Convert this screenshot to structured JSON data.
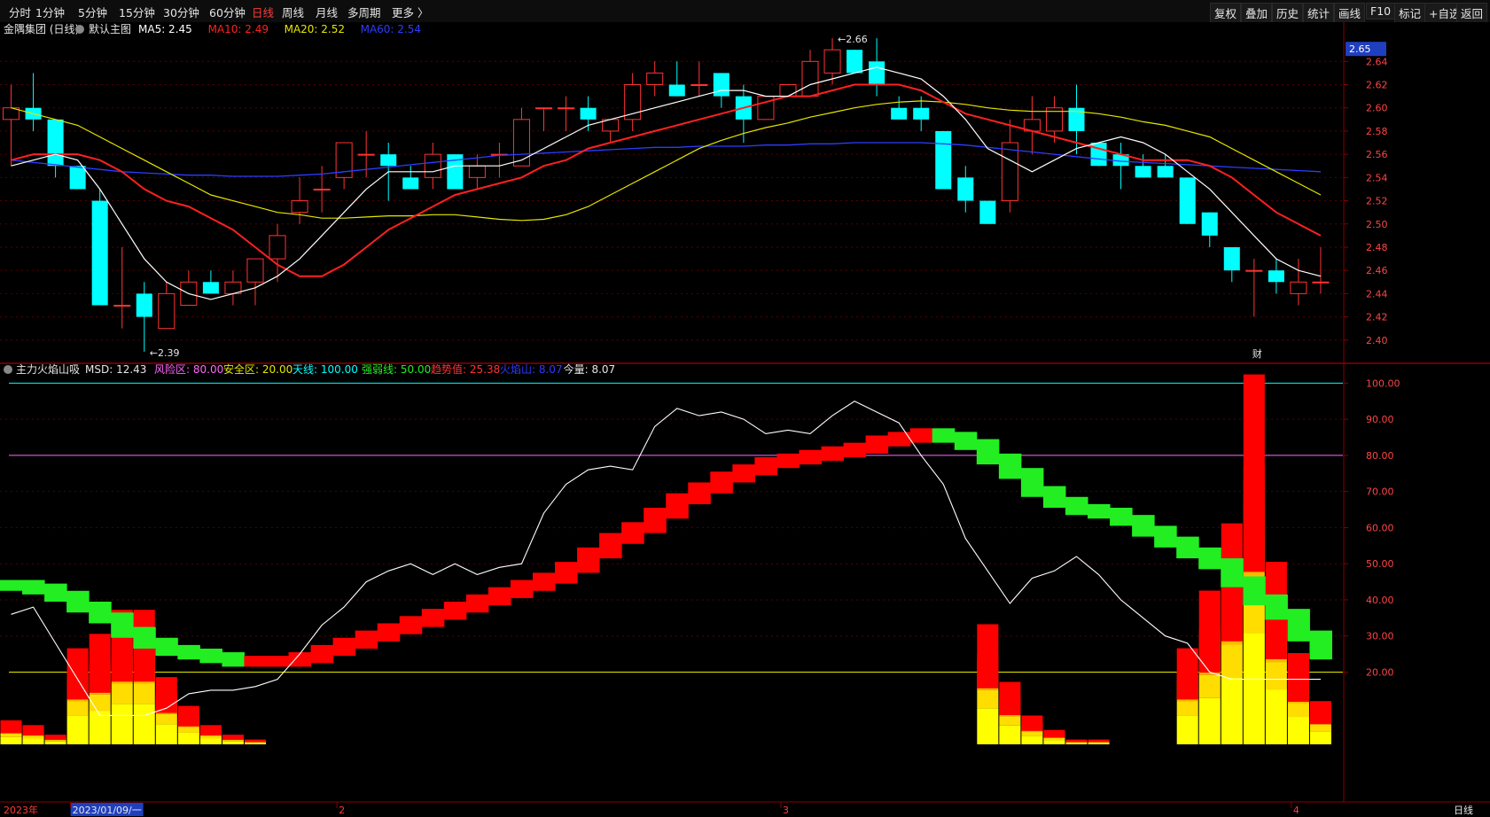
{
  "toolbar": {
    "periods": [
      "分时",
      "1分钟",
      "5分钟",
      "15分钟",
      "30分钟",
      "60分钟",
      "日线",
      "周线",
      "月线",
      "多周期",
      "更多 〉"
    ],
    "active_period": "日线",
    "right_buttons": [
      "复权",
      "叠加",
      "历史",
      "统计",
      "画线",
      "F10",
      "标记",
      "+自选",
      "返回"
    ]
  },
  "colors": {
    "up": "#ff3333",
    "down": "#00ffff",
    "ma5": "#ffffff",
    "ma10": "#ff2020",
    "ma20": "#e6e600",
    "ma60": "#2d3cff",
    "msd_line": "#ffffff",
    "red_band": "#ff0000",
    "green_band": "#22ee22",
    "risk_line": "#ff66ff",
    "safe_line": "#e6e600",
    "sky_line": "#00ffff"
  },
  "chart_data": [
    {
      "type": "candlestick",
      "title": "金隅集团 (日线)",
      "main_label": "默认主图",
      "indicators": [
        {
          "name": "MA5",
          "value": "2.45",
          "color": "#ffffff"
        },
        {
          "name": "MA10",
          "value": "2.49",
          "color": "#ff2020"
        },
        {
          "name": "MA20",
          "value": "2.52",
          "color": "#e6e600"
        },
        {
          "name": "MA60",
          "value": "2.54",
          "color": "#2d3cff"
        }
      ],
      "ylim": [
        2.38,
        2.67
      ],
      "yticks": [
        "2.40",
        "2.42",
        "2.44",
        "2.46",
        "2.48",
        "2.50",
        "2.52",
        "2.54",
        "2.56",
        "2.58",
        "2.60",
        "2.62",
        "2.64"
      ],
      "current_price": "2.65",
      "annotations": [
        {
          "text": "2.66",
          "index": 37,
          "value": 2.66
        },
        {
          "text": "2.39",
          "index": 6,
          "value": 2.39
        }
      ],
      "marker": {
        "text": "财",
        "index": 56
      },
      "candles": [
        {
          "o": 2.59,
          "h": 2.62,
          "l": 2.55,
          "c": 2.6
        },
        {
          "o": 2.6,
          "h": 2.63,
          "l": 2.58,
          "c": 2.59
        },
        {
          "o": 2.59,
          "h": 2.59,
          "l": 2.54,
          "c": 2.55
        },
        {
          "o": 2.55,
          "h": 2.55,
          "l": 2.53,
          "c": 2.53
        },
        {
          "o": 2.52,
          "h": 2.53,
          "l": 2.43,
          "c": 2.43
        },
        {
          "o": 2.43,
          "h": 2.48,
          "l": 2.41,
          "c": 2.43
        },
        {
          "o": 2.44,
          "h": 2.45,
          "l": 2.39,
          "c": 2.42
        },
        {
          "o": 2.41,
          "h": 2.45,
          "l": 2.41,
          "c": 2.44
        },
        {
          "o": 2.43,
          "h": 2.46,
          "l": 2.43,
          "c": 2.45
        },
        {
          "o": 2.45,
          "h": 2.46,
          "l": 2.44,
          "c": 2.44
        },
        {
          "o": 2.44,
          "h": 2.46,
          "l": 2.43,
          "c": 2.45
        },
        {
          "o": 2.45,
          "h": 2.47,
          "l": 2.43,
          "c": 2.47
        },
        {
          "o": 2.47,
          "h": 2.5,
          "l": 2.45,
          "c": 2.49
        },
        {
          "o": 2.51,
          "h": 2.54,
          "l": 2.5,
          "c": 2.52
        },
        {
          "o": 2.53,
          "h": 2.55,
          "l": 2.51,
          "c": 2.53
        },
        {
          "o": 2.54,
          "h": 2.57,
          "l": 2.53,
          "c": 2.57
        },
        {
          "o": 2.56,
          "h": 2.58,
          "l": 2.54,
          "c": 2.56
        },
        {
          "o": 2.56,
          "h": 2.57,
          "l": 2.52,
          "c": 2.55
        },
        {
          "o": 2.54,
          "h": 2.55,
          "l": 2.53,
          "c": 2.53
        },
        {
          "o": 2.54,
          "h": 2.57,
          "l": 2.53,
          "c": 2.56
        },
        {
          "o": 2.56,
          "h": 2.56,
          "l": 2.53,
          "c": 2.53
        },
        {
          "o": 2.54,
          "h": 2.56,
          "l": 2.53,
          "c": 2.55
        },
        {
          "o": 2.56,
          "h": 2.57,
          "l": 2.54,
          "c": 2.56
        },
        {
          "o": 2.55,
          "h": 2.6,
          "l": 2.55,
          "c": 2.59
        },
        {
          "o": 2.6,
          "h": 2.6,
          "l": 2.58,
          "c": 2.6
        },
        {
          "o": 2.6,
          "h": 2.61,
          "l": 2.58,
          "c": 2.6
        },
        {
          "o": 2.6,
          "h": 2.61,
          "l": 2.58,
          "c": 2.59
        },
        {
          "o": 2.58,
          "h": 2.59,
          "l": 2.57,
          "c": 2.59
        },
        {
          "o": 2.59,
          "h": 2.63,
          "l": 2.58,
          "c": 2.62
        },
        {
          "o": 2.62,
          "h": 2.64,
          "l": 2.61,
          "c": 2.63
        },
        {
          "o": 2.62,
          "h": 2.64,
          "l": 2.61,
          "c": 2.61
        },
        {
          "o": 2.62,
          "h": 2.64,
          "l": 2.61,
          "c": 2.62
        },
        {
          "o": 2.63,
          "h": 2.63,
          "l": 2.6,
          "c": 2.61
        },
        {
          "o": 2.61,
          "h": 2.62,
          "l": 2.57,
          "c": 2.59
        },
        {
          "o": 2.59,
          "h": 2.61,
          "l": 2.59,
          "c": 2.61
        },
        {
          "o": 2.61,
          "h": 2.62,
          "l": 2.61,
          "c": 2.62
        },
        {
          "o": 2.61,
          "h": 2.65,
          "l": 2.61,
          "c": 2.64
        },
        {
          "o": 2.63,
          "h": 2.66,
          "l": 2.62,
          "c": 2.65
        },
        {
          "o": 2.65,
          "h": 2.65,
          "l": 2.63,
          "c": 2.63
        },
        {
          "o": 2.64,
          "h": 2.66,
          "l": 2.61,
          "c": 2.62
        },
        {
          "o": 2.6,
          "h": 2.61,
          "l": 2.59,
          "c": 2.59
        },
        {
          "o": 2.6,
          "h": 2.61,
          "l": 2.58,
          "c": 2.59
        },
        {
          "o": 2.58,
          "h": 2.58,
          "l": 2.53,
          "c": 2.53
        },
        {
          "o": 2.54,
          "h": 2.55,
          "l": 2.51,
          "c": 2.52
        },
        {
          "o": 2.52,
          "h": 2.52,
          "l": 2.5,
          "c": 2.5
        },
        {
          "o": 2.52,
          "h": 2.59,
          "l": 2.51,
          "c": 2.57
        },
        {
          "o": 2.58,
          "h": 2.61,
          "l": 2.56,
          "c": 2.59
        },
        {
          "o": 2.58,
          "h": 2.61,
          "l": 2.57,
          "c": 2.6
        },
        {
          "o": 2.6,
          "h": 2.62,
          "l": 2.56,
          "c": 2.58
        },
        {
          "o": 2.57,
          "h": 2.57,
          "l": 2.55,
          "c": 2.55
        },
        {
          "o": 2.56,
          "h": 2.57,
          "l": 2.53,
          "c": 2.55
        },
        {
          "o": 2.55,
          "h": 2.56,
          "l": 2.54,
          "c": 2.54
        },
        {
          "o": 2.55,
          "h": 2.56,
          "l": 2.54,
          "c": 2.54
        },
        {
          "o": 2.54,
          "h": 2.54,
          "l": 2.5,
          "c": 2.5
        },
        {
          "o": 2.51,
          "h": 2.51,
          "l": 2.48,
          "c": 2.49
        },
        {
          "o": 2.48,
          "h": 2.48,
          "l": 2.45,
          "c": 2.46
        },
        {
          "o": 2.46,
          "h": 2.47,
          "l": 2.42,
          "c": 2.46
        },
        {
          "o": 2.46,
          "h": 2.47,
          "l": 2.44,
          "c": 2.45
        },
        {
          "o": 2.44,
          "h": 2.47,
          "l": 2.43,
          "c": 2.45
        },
        {
          "o": 2.45,
          "h": 2.48,
          "l": 2.44,
          "c": 2.45
        }
      ],
      "ma5": [
        2.55,
        2.555,
        2.56,
        2.555,
        2.53,
        2.5,
        2.47,
        2.45,
        2.44,
        2.435,
        2.44,
        2.445,
        2.455,
        2.47,
        2.49,
        2.51,
        2.53,
        2.545,
        2.545,
        2.545,
        2.55,
        2.55,
        2.55,
        2.555,
        2.565,
        2.575,
        2.585,
        2.59,
        2.595,
        2.6,
        2.605,
        2.61,
        2.615,
        2.615,
        2.61,
        2.61,
        2.62,
        2.625,
        2.63,
        2.635,
        2.63,
        2.625,
        2.61,
        2.59,
        2.565,
        2.555,
        2.545,
        2.555,
        2.565,
        2.57,
        2.575,
        2.57,
        2.56,
        2.545,
        2.53,
        2.51,
        2.49,
        2.47,
        2.46,
        2.455
      ],
      "ma10": [
        2.555,
        2.56,
        2.56,
        2.56,
        2.555,
        2.545,
        2.53,
        2.52,
        2.515,
        2.505,
        2.495,
        2.48,
        2.465,
        2.455,
        2.455,
        2.465,
        2.48,
        2.495,
        2.505,
        2.515,
        2.525,
        2.53,
        2.535,
        2.54,
        2.55,
        2.555,
        2.565,
        2.57,
        2.575,
        2.58,
        2.585,
        2.59,
        2.595,
        2.6,
        2.605,
        2.61,
        2.61,
        2.615,
        2.62,
        2.62,
        2.62,
        2.615,
        2.605,
        2.595,
        2.59,
        2.585,
        2.58,
        2.575,
        2.57,
        2.565,
        2.56,
        2.555,
        2.555,
        2.555,
        2.55,
        2.54,
        2.525,
        2.51,
        2.5,
        2.49
      ],
      "ma20": [
        2.6,
        2.595,
        2.59,
        2.585,
        2.575,
        2.565,
        2.555,
        2.545,
        2.535,
        2.525,
        2.52,
        2.515,
        2.51,
        2.508,
        2.505,
        2.505,
        2.506,
        2.507,
        2.507,
        2.508,
        2.508,
        2.506,
        2.504,
        2.503,
        2.504,
        2.508,
        2.515,
        2.525,
        2.535,
        2.545,
        2.555,
        2.565,
        2.572,
        2.578,
        2.583,
        2.587,
        2.592,
        2.596,
        2.6,
        2.603,
        2.605,
        2.606,
        2.605,
        2.603,
        2.6,
        2.598,
        2.597,
        2.597,
        2.597,
        2.595,
        2.592,
        2.588,
        2.585,
        2.58,
        2.575,
        2.565,
        2.555,
        2.545,
        2.535,
        2.525
      ],
      "ma60": [
        2.555,
        2.553,
        2.551,
        2.549,
        2.547,
        2.545,
        2.544,
        2.543,
        2.542,
        2.542,
        2.541,
        2.541,
        2.541,
        2.542,
        2.543,
        2.545,
        2.547,
        2.549,
        2.551,
        2.553,
        2.555,
        2.557,
        2.559,
        2.56,
        2.561,
        2.562,
        2.563,
        2.564,
        2.565,
        2.566,
        2.566,
        2.567,
        2.567,
        2.567,
        2.568,
        2.568,
        2.569,
        2.569,
        2.57,
        2.57,
        2.57,
        2.57,
        2.569,
        2.568,
        2.566,
        2.564,
        2.562,
        2.56,
        2.558,
        2.556,
        2.554,
        2.553,
        2.552,
        2.551,
        2.55,
        2.549,
        2.548,
        2.547,
        2.546,
        2.545
      ]
    },
    {
      "type": "indicator",
      "title": "主力火焰山吸",
      "labels": [
        {
          "name": "MSD",
          "value": "12.43",
          "color": "#e6e6e6"
        },
        {
          "name": "风险区",
          "value": "80.00",
          "color": "#ff66ff"
        },
        {
          "name": "安全区",
          "value": "20.00",
          "color": "#e6e600"
        },
        {
          "name": "天线",
          "value": "100.00",
          "color": "#00ffff"
        },
        {
          "name": "强弱线",
          "value": "50.00",
          "color": "#22ee22"
        },
        {
          "name": "趋势值",
          "value": "25.38",
          "color": "#ff3333"
        },
        {
          "name": "火焰山",
          "value": "8.07",
          "color": "#2d3cff"
        },
        {
          "name": "今量",
          "value": "8.07",
          "color": "#e6e6e6"
        }
      ],
      "ylim": [
        0,
        105
      ],
      "yticks": [
        "20.00",
        "30.00",
        "40.00",
        "50.00",
        "60.00",
        "70.00",
        "80.00",
        "90.00",
        "100.00"
      ],
      "levels": {
        "sky": 100,
        "risk": 80,
        "strong_weak": 50,
        "safe": 20
      },
      "msd": [
        36,
        38,
        28,
        18,
        8,
        8,
        8,
        10,
        14,
        15,
        15,
        16,
        18,
        25,
        33,
        38,
        45,
        48,
        50,
        47,
        50,
        47,
        49,
        50,
        64,
        72,
        76,
        77,
        76,
        88,
        93,
        91,
        92,
        90,
        86,
        87,
        86,
        91,
        95,
        92,
        89,
        80,
        72,
        57,
        48,
        39,
        46,
        48,
        52,
        47,
        40,
        35,
        30,
        28,
        20,
        18,
        18,
        18,
        18,
        18
      ],
      "trend": [
        44,
        43,
        41,
        38,
        35,
        31,
        28,
        26,
        25,
        24,
        23,
        23,
        23,
        24,
        26,
        28,
        30,
        32,
        34,
        36,
        38,
        40,
        42,
        44,
        46,
        49,
        53,
        57,
        60,
        64,
        68,
        71,
        74,
        76,
        78,
        79,
        80,
        81,
        82,
        84,
        85,
        86,
        85,
        83,
        79,
        75,
        70,
        67,
        65,
        64,
        62,
        59,
        56,
        53,
        50,
        45,
        40,
        36,
        30,
        25
      ],
      "trend_up": [
        false,
        false,
        false,
        false,
        false,
        false,
        false,
        false,
        false,
        false,
        false,
        true,
        true,
        true,
        true,
        true,
        true,
        true,
        true,
        true,
        true,
        true,
        true,
        true,
        true,
        true,
        true,
        true,
        true,
        true,
        true,
        true,
        true,
        true,
        true,
        true,
        true,
        true,
        true,
        true,
        true,
        true,
        false,
        false,
        false,
        false,
        false,
        false,
        false,
        false,
        false,
        false,
        false,
        false,
        false,
        false,
        false,
        false,
        false,
        false
      ],
      "flame": [
        5,
        4,
        2,
        20,
        23,
        28,
        28,
        14,
        8,
        4,
        2,
        1,
        0,
        0,
        0,
        0,
        0,
        0,
        0,
        0,
        0,
        0,
        0,
        0,
        0,
        0,
        0,
        0,
        0,
        0,
        0,
        0,
        0,
        0,
        0,
        0,
        0,
        0,
        0,
        0,
        0,
        0,
        0,
        0,
        25,
        13,
        6,
        3,
        1,
        1,
        0,
        0,
        0,
        20,
        32,
        46,
        77,
        38,
        19,
        9
      ]
    }
  ],
  "xaxis": {
    "labels": [
      {
        "text": "2023年",
        "index": 0,
        "color": "#ff3b3b"
      },
      {
        "text": "2023/01/09/一",
        "index": 3,
        "color": "#e6e6e6",
        "highlight": true
      },
      {
        "text": "2",
        "index": 15,
        "color": "#ff3b3b"
      },
      {
        "text": "3",
        "index": 35,
        "color": "#ff3b3b"
      },
      {
        "text": "4",
        "index": 58,
        "color": "#ff3b3b"
      }
    ],
    "period_label": "日线"
  }
}
